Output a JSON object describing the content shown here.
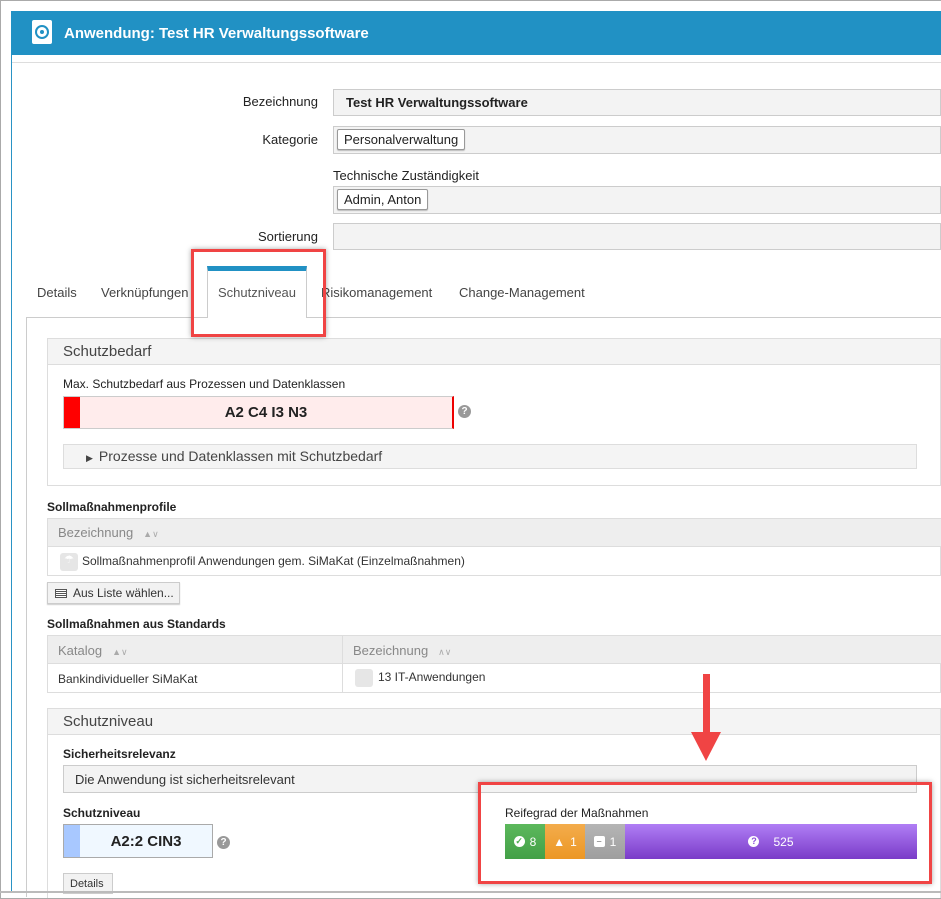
{
  "header": {
    "title": "Anwendung: Test HR Verwaltungssoftware",
    "icon": "target-icon",
    "color": "#2191c4"
  },
  "form": {
    "bezeichnung_label": "Bezeichnung",
    "bezeichnung_value": "Test HR Verwaltungssoftware",
    "kategorie_label": "Kategorie",
    "kategorie_value": "Personalverwaltung",
    "zustaendigkeit_label": "Technische Zuständigkeit",
    "zustaendigkeit_value": "Admin, Anton",
    "sortierung_label": "Sortierung",
    "sortierung_value": ""
  },
  "tabs": [
    {
      "label": "Details"
    },
    {
      "label": "Verknüpfungen"
    },
    {
      "label": "Schutzniveau",
      "active": true
    },
    {
      "label": "Risikomanagement"
    },
    {
      "label": "Change-Management"
    }
  ],
  "schutzbedarf": {
    "title": "Schutzbedarf",
    "max_label": "Max. Schutzbedarf aus Prozessen und Datenklassen",
    "max_value": "A2 C4 I3 N3",
    "max_color": "#ff0000",
    "collapsible": "Prozesse und Datenklassen mit Schutzbedarf"
  },
  "profile": {
    "title": "Sollmaßnahmenprofile",
    "column": "Bezeichnung",
    "rows": [
      {
        "label": "Sollmaßnahmenprofil Anwendungen gem. SiMaKat (Einzelmaßnahmen)",
        "icon": "umbrella-icon"
      }
    ],
    "choose_button": "Aus Liste wählen..."
  },
  "standards": {
    "title": "Sollmaßnahmen aus Standards",
    "columns": [
      "Katalog",
      "Bezeichnung"
    ],
    "rows": [
      {
        "katalog": "Bankindividueller SiMaKat",
        "bezeichnung": "13 IT-Anwendungen"
      }
    ]
  },
  "schutzniveau": {
    "title": "Schutzniveau",
    "relevanz_label": "Sicherheitsrelevanz",
    "relevanz_value": "Die Anwendung ist sicherheitsrelevant",
    "level_label": "Schutzniveau",
    "level_value": "A2:2 CIN3",
    "level_color": "#a8c8ff",
    "details_button": "Details"
  },
  "reifegrad": {
    "label": "Reifegrad der Maßnahmen",
    "segments": [
      {
        "icon": "check-circle-icon",
        "count": "8",
        "color": "#4caf50"
      },
      {
        "icon": "warning-icon",
        "count": "1",
        "color": "#f0a030"
      },
      {
        "icon": "minus-square-icon",
        "count": "1",
        "color": "#a8a8a8"
      },
      {
        "icon": "question-circle-icon",
        "count": "525",
        "color": "#8a4fd8"
      }
    ]
  }
}
